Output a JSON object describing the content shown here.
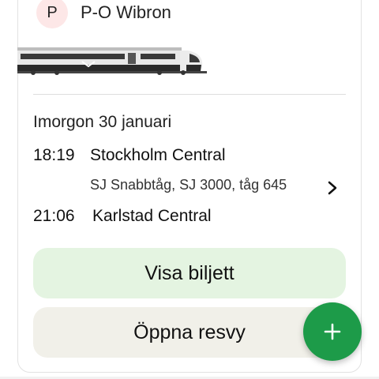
{
  "traveler": {
    "initial": "P",
    "name": "P-O Wibron"
  },
  "trip": {
    "date": "Imorgon 30 januari",
    "departure": {
      "time": "18:19",
      "station": "Stockholm Central"
    },
    "details": "SJ Snabbtåg, SJ 3000, tåg 645",
    "arrival": {
      "time": "21:06",
      "station": "Karlstad Central"
    }
  },
  "actions": {
    "show_ticket": "Visa biljett",
    "open_trip": "Öppna resvy"
  },
  "icons": {
    "details": "chevron-right-icon",
    "add": "plus-icon",
    "train": "train-image"
  },
  "colors": {
    "avatar_bg": "#fde7e7",
    "primary_button": "#e4f4e1",
    "secondary_button": "#f1f0e9",
    "fab": "#1d9b49"
  }
}
